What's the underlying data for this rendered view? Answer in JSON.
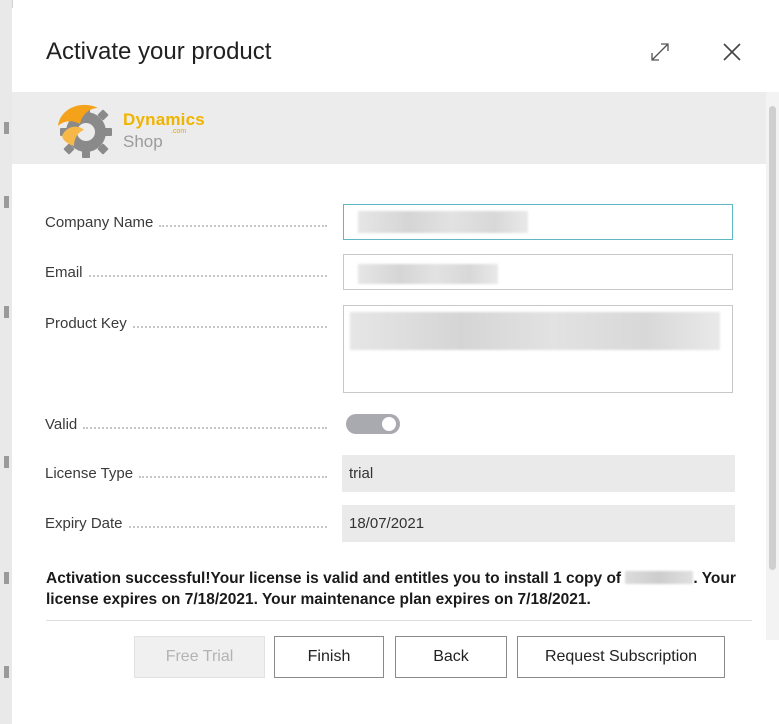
{
  "dialog": {
    "title": "Activate your product",
    "expand_icon": "expand-diagonal-icon",
    "close_icon": "close-icon"
  },
  "logo": {
    "word1": "Dynamics",
    "com": ".com",
    "word2": "Shop",
    "colors": {
      "orange": "#f5a21b",
      "gear": "#8a8a8a",
      "text1": "#f0b400",
      "text2": "#9b9b9b"
    }
  },
  "fields": {
    "company_name": {
      "label": "Company Name",
      "value": ""
    },
    "email": {
      "label": "Email",
      "value": ""
    },
    "product_key": {
      "label": "Product Key",
      "value": ""
    },
    "valid": {
      "label": "Valid",
      "checked": true
    },
    "license_type": {
      "label": "License Type",
      "value": "trial"
    },
    "expiry_date": {
      "label": "Expiry Date",
      "value": "18/07/2021"
    }
  },
  "message": {
    "part1": "Activation successful!Your license is valid and entitles you to install 1 copy of",
    "part2": ". Your license expires on 7/18/2021. Your maintenance plan expires on 7/18/2021."
  },
  "buttons": {
    "free_trial": "Free Trial",
    "finish": "Finish",
    "back": "Back",
    "request_subscription": "Request Subscription"
  },
  "colors": {
    "accent_focus": "#5fb7c4",
    "banner_bg": "#ececec",
    "readonly_bg": "#eaeaea",
    "toggle_on": "#a9a9b0"
  }
}
